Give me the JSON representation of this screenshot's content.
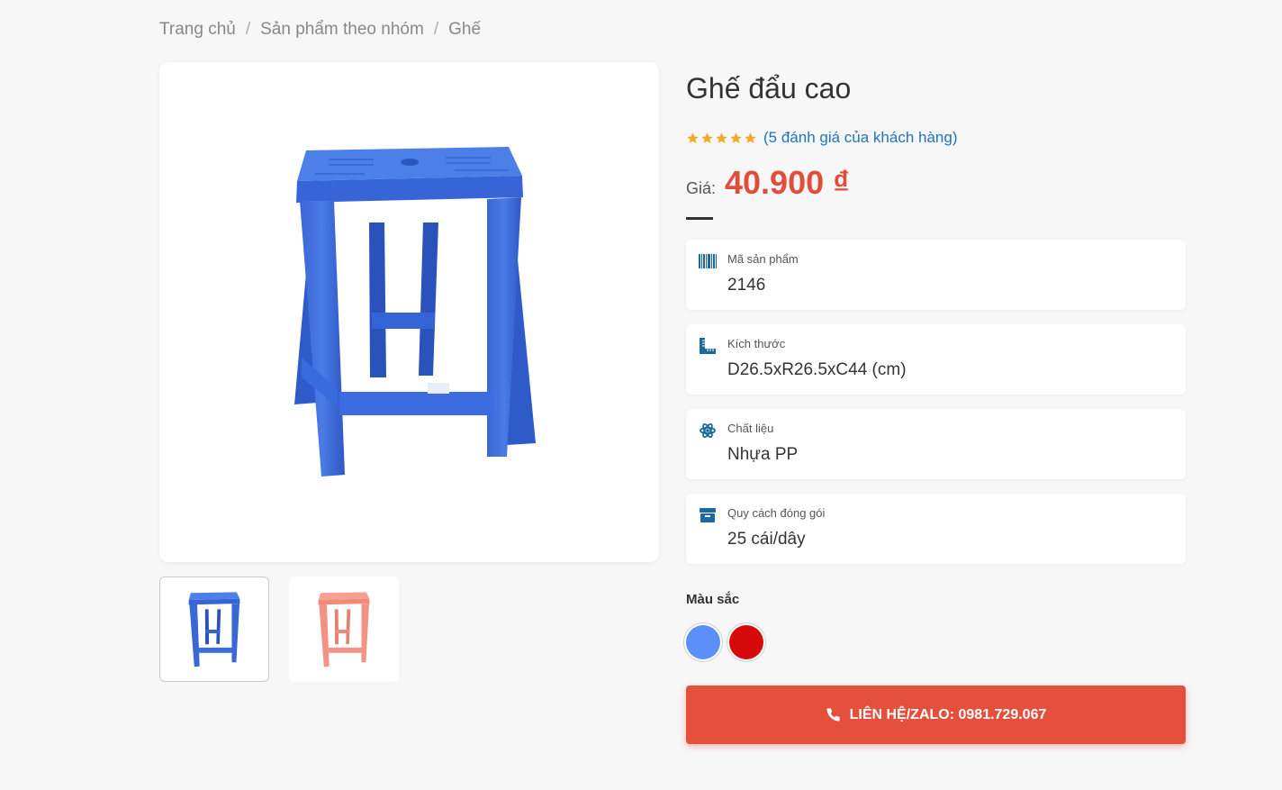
{
  "breadcrumb": {
    "home": "Trang chủ",
    "category": "Sản phẩm theo nhóm",
    "current": "Ghế",
    "separator": "/"
  },
  "product": {
    "title": "Ghế đẩu cao",
    "rating": 5,
    "reviews_text": "(5 đánh giá của khách hàng)",
    "price_label": "Giá:",
    "price": "40.900 ₫"
  },
  "details": [
    {
      "icon": "barcode-icon",
      "label": "Mã sản phẩm",
      "value": "2146"
    },
    {
      "icon": "ruler-icon",
      "label": "Kích thước",
      "value": "D26.5xR26.5xC44 (cm)"
    },
    {
      "icon": "atom-icon",
      "label": "Chất liệu",
      "value": "Nhựa PP"
    },
    {
      "icon": "box-icon",
      "label": "Quy cách đóng gói",
      "value": "25 cái/dây"
    }
  ],
  "colors": {
    "title": "Màu sắc",
    "options": [
      "#5b8ff9",
      "#d60a0a"
    ]
  },
  "contact_button": "LIÊN HỆ/ZALO: 0981.729.067",
  "theme": {
    "accent": "#e5503d",
    "price_color": "#e44c3a",
    "link_color": "#1e73be",
    "icon_color": "#1a6aa0",
    "star_color": "#f5a623"
  }
}
